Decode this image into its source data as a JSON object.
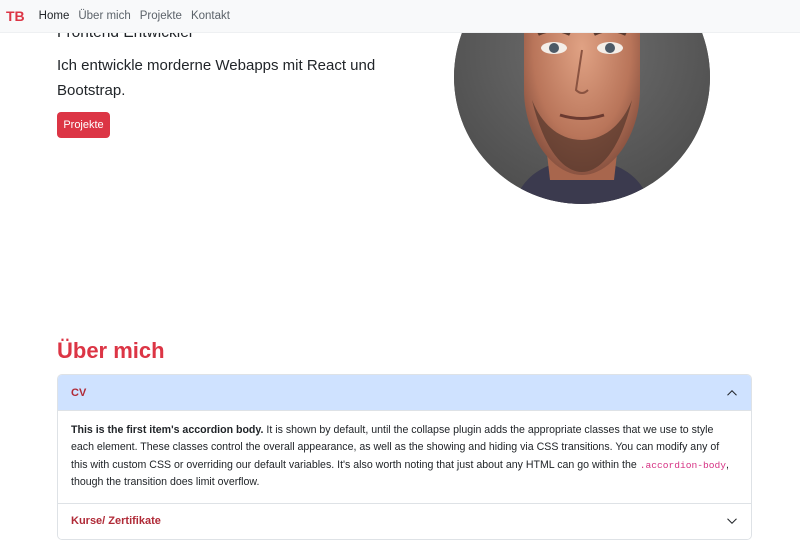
{
  "navbar": {
    "brand": "TB",
    "links": [
      "Home",
      "Über mich",
      "Projekte",
      "Kontakt"
    ]
  },
  "hero": {
    "role": "Frontend Entwickler",
    "text": "Ich entwickle morderne Webapps mit React und Bootstrap.",
    "button_label": "Projekte",
    "portrait_icon": "portrait-photo"
  },
  "about": {
    "title": "Über mich",
    "accordion": [
      {
        "label": "CV",
        "expanded": true,
        "body_strong": "This is the first item's accordion body.",
        "body_text_1": " It is shown by default, until the collapse plugin adds the appropriate classes that we use to style each element. These classes control the overall appearance, as well as the showing and hiding via CSS transitions. You can modify any of this with custom CSS or overriding our default variables. It's also worth noting that just about any HTML can go within the ",
        "body_code": ".accordion-body",
        "body_text_2": ", though the transition does limit overflow."
      },
      {
        "label": "Kurse/ Zertifikate",
        "expanded": false
      }
    ]
  },
  "colors": {
    "brand": "#dc3545",
    "accordion_active_bg": "#cfe2ff",
    "navbar_bg": "#f8f9fa"
  }
}
